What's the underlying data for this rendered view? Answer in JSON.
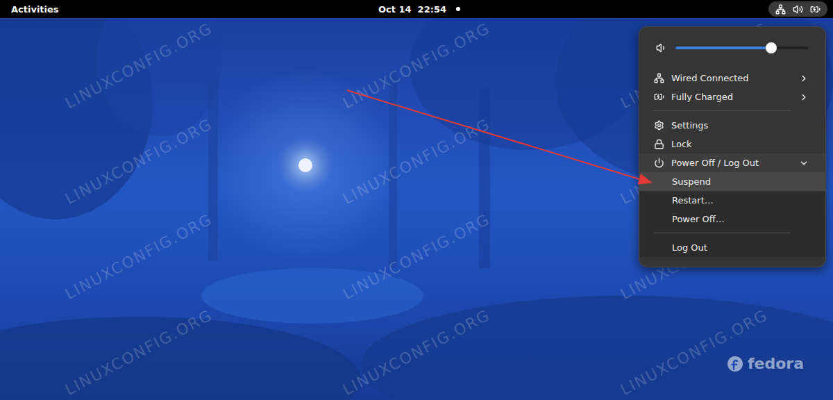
{
  "top_bar": {
    "activities": "Activities",
    "clock": "Oct 14  22:54",
    "notification_dot": true,
    "status_area_open": true
  },
  "system_menu": {
    "open": true,
    "volume": {
      "level": 0.72
    },
    "items": [
      {
        "kind": "submenu",
        "label": "Wired Connected",
        "selected": false
      },
      {
        "kind": "submenu",
        "label": "Fully Charged",
        "selected": false
      },
      {
        "kind": "separator"
      },
      {
        "kind": "action",
        "label": "Settings",
        "selected": false
      },
      {
        "kind": "action",
        "label": "Lock",
        "selected": false
      },
      {
        "kind": "expander",
        "label": "Power Off / Log Out",
        "expanded": true,
        "selected": false
      },
      {
        "kind": "subitem",
        "label": "Suspend",
        "selected": true
      },
      {
        "kind": "subitem",
        "label": "Restart…",
        "selected": false
      },
      {
        "kind": "subitem",
        "label": "Power Off…",
        "selected": false
      },
      {
        "kind": "separator"
      },
      {
        "kind": "subitem",
        "label": "Log Out",
        "selected": false
      }
    ]
  },
  "watermark": {
    "text": "LINUXCONFIG.ORG"
  },
  "logo": {
    "text": "fedora"
  },
  "annotation": {
    "kind": "arrow",
    "color": "#e53935"
  }
}
